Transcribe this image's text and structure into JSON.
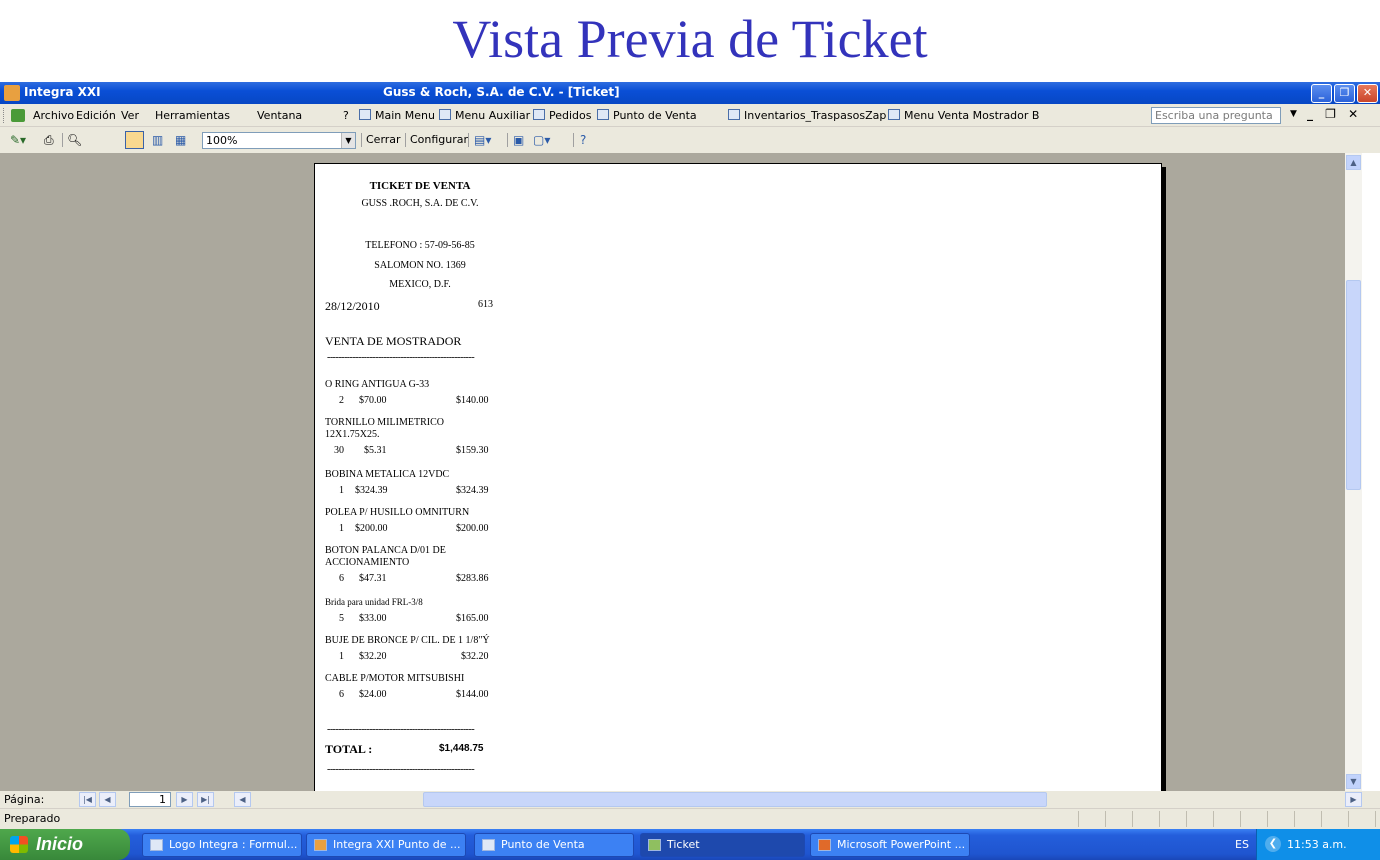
{
  "slide_title": "Vista Previa de Ticket",
  "window": {
    "app_name": "Integra XXI",
    "title": "Guss & Roch, S.A. de C.V. - [Ticket]"
  },
  "menu": {
    "items": [
      "Archivo",
      "Edición",
      "Ver",
      "Herramientas",
      "Ventana",
      "?"
    ],
    "shortcuts": [
      "Main Menu",
      "Menu Auxiliar",
      "Pedidos",
      "Punto de Venta",
      "Inventarios_TraspasosZap",
      "Menu Venta Mostrador B"
    ],
    "help_placeholder": "Escriba una pregunta"
  },
  "toolbar": {
    "zoom": "100%",
    "close_label": "Cerrar",
    "configure_label": "Configurar"
  },
  "ticket": {
    "heading": "TICKET DE VENTA",
    "company": "GUSS .ROCH, S.A. DE C.V.",
    "phone": "TELEFONO : 57-09-56-85",
    "street": "SALOMON NO. 1369",
    "city": "MEXICO, D.F.",
    "date": "28/12/2010",
    "number": "613",
    "sale_type": "VENTA DE MOSTRADOR",
    "dashes": "----------------------------------------------------",
    "items": [
      {
        "desc": "O RING ANTIGUA G-33",
        "qty": "2",
        "price": "$70.00",
        "amount": "$140.00"
      },
      {
        "desc": "TORNILLO MILIMETRICO",
        "desc2": "12X1.75X25.",
        "qty": "30",
        "price": "$5.31",
        "amount": "$159.30"
      },
      {
        "desc": "BOBINA METALICA 12VDC",
        "qty": "1",
        "price": "$324.39",
        "amount": "$324.39"
      },
      {
        "desc": "POLEA P/ HUSILLO OMNITURN",
        "qty": "1",
        "price": "$200.00",
        "amount": "$200.00"
      },
      {
        "desc": "BOTON PALANCA D/01 DE",
        "desc2": "ACCIONAMIENTO",
        "qty": "6",
        "price": "$47.31",
        "amount": "$283.86"
      },
      {
        "desc": "Brida para unidad FRL-3/8",
        "qty": "5",
        "price": "$33.00",
        "amount": "$165.00"
      },
      {
        "desc": "BUJE DE BRONCE P/ CIL. DE 1 1/8\"Ý",
        "qty": "1",
        "price": "$32.20",
        "amount": "$32.20"
      },
      {
        "desc": "CABLE P/MOTOR MITSUBISHI",
        "qty": "6",
        "price": "$24.00",
        "amount": "$144.00"
      }
    ],
    "total_label": "TOTAL :",
    "total": "$1,448.75"
  },
  "nav": {
    "label": "Página:",
    "page": "1"
  },
  "status": "Preparado",
  "taskbar": {
    "start": "Inicio",
    "tasks": [
      "Logo Integra : Formul...",
      "Integra XXI Punto de ...",
      "Punto de Venta",
      "Ticket",
      "Microsoft PowerPoint ..."
    ],
    "lang": "ES",
    "clock": "11:53 a.m."
  },
  "icons": [
    "app-icon",
    "printer-icon",
    "magnifier-icon",
    "one-page-icon",
    "two-pages-icon",
    "multiple-pages-icon",
    "word-icon",
    "database-window-icon",
    "new-object-icon",
    "help-icon",
    "start-flag-icon"
  ]
}
